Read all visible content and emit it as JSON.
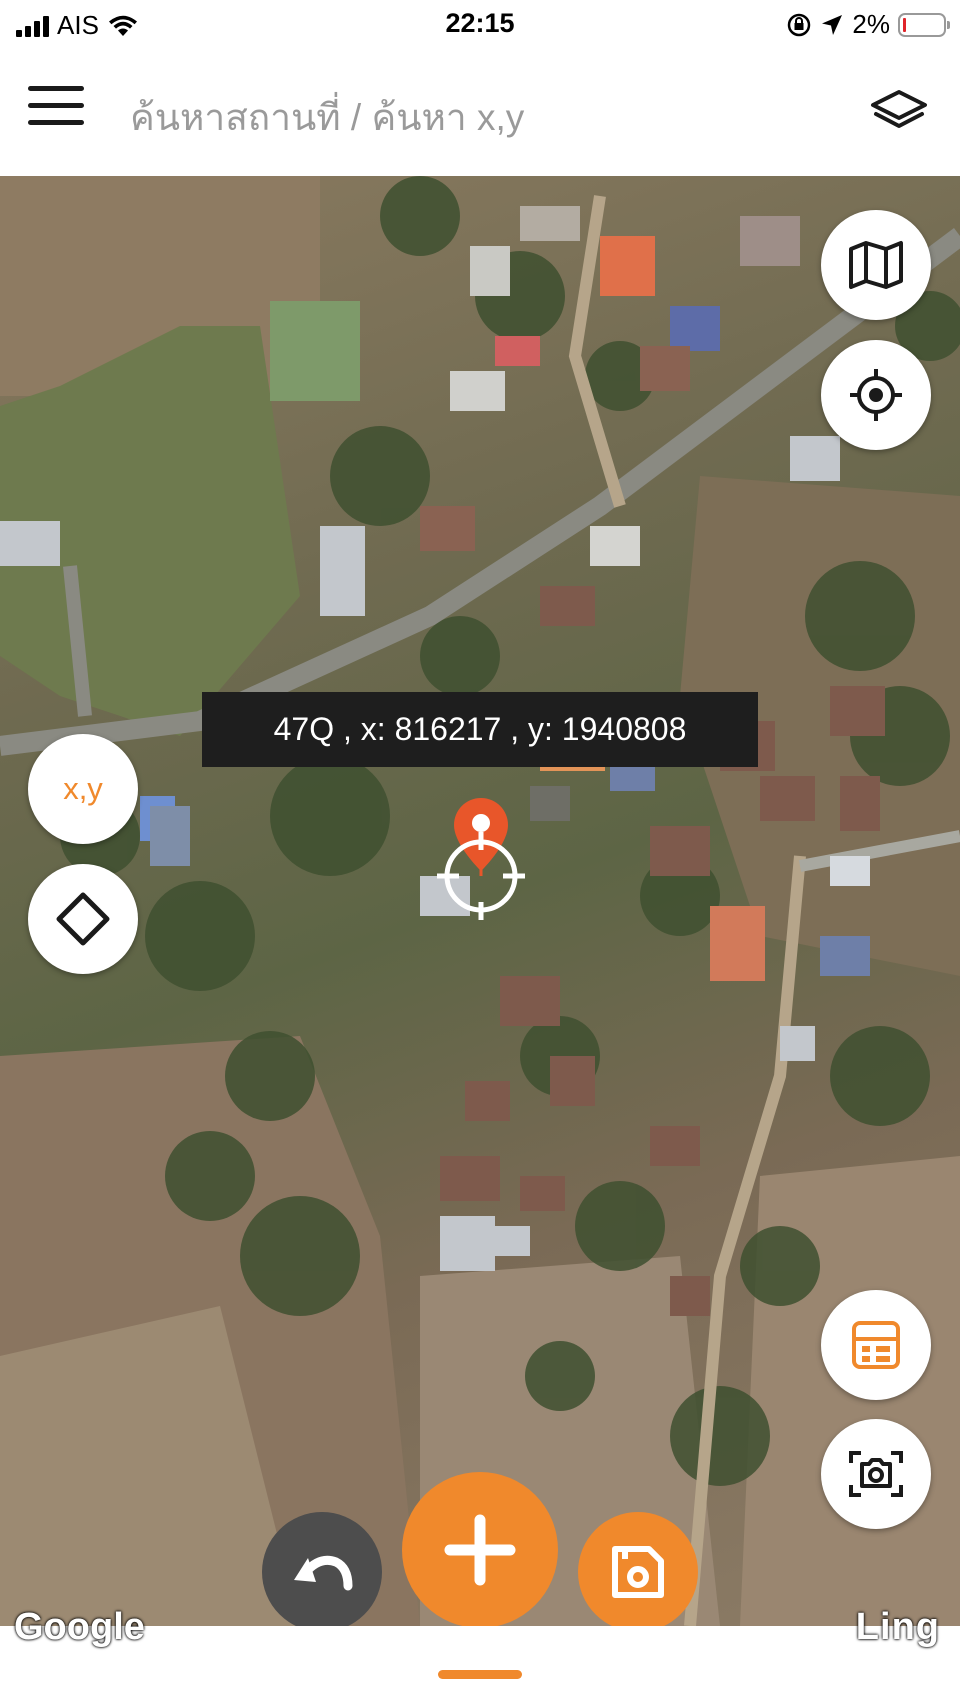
{
  "status_bar": {
    "carrier": "AIS",
    "time": "22:15",
    "battery_percent": "2%",
    "battery_level": 0.02,
    "battery_color": "#e0242a"
  },
  "header": {
    "menu_icon": "hamburger-menu-icon",
    "title": "ค้นหาสถานที่ / ค้นหา x,y",
    "layers_icon": "layers-icon"
  },
  "map": {
    "coordinate_label": "47Q , x: 816217 , y: 1940808",
    "marker_color": "#e8562a",
    "accent_color": "#f0892c",
    "google_attribution": "Google",
    "ling_logo": "Ling"
  },
  "controls": {
    "map_type_icon": "map-icon",
    "locate_icon": "gps-locate-icon",
    "xy_button_label": "x,y",
    "polygon_icon": "polygon-diamond-icon",
    "calculator_icon": "calculator-icon",
    "screenshot_icon": "screenshot-capture-icon",
    "undo_icon": "undo-icon",
    "add_icon": "plus-icon",
    "save_icon": "save-file-icon"
  }
}
